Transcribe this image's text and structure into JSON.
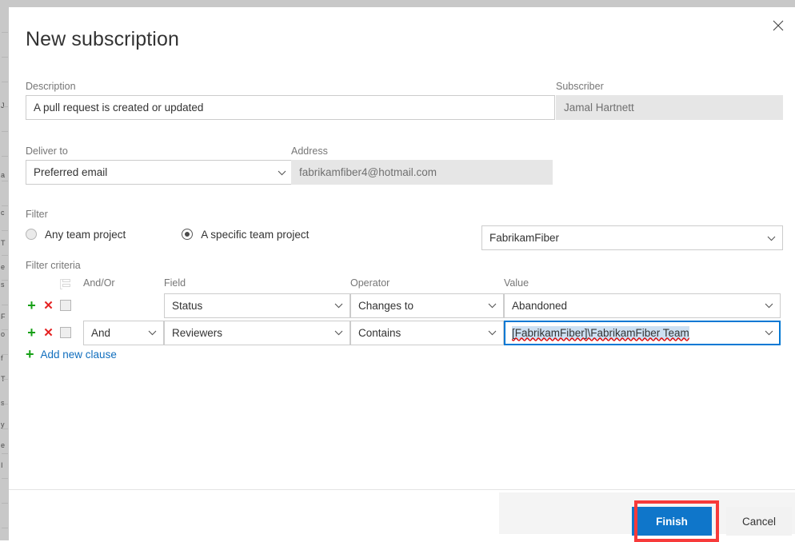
{
  "dialog": {
    "title": "New subscription",
    "close_icon": "close-icon"
  },
  "form": {
    "description_label": "Description",
    "description_value": "A pull request is created or updated",
    "subscriber_label": "Subscriber",
    "subscriber_value": "Jamal Hartnett",
    "deliver_to_label": "Deliver to",
    "deliver_to_value": "Preferred email",
    "address_label": "Address",
    "address_value": "fabrikamfiber4@hotmail.com"
  },
  "filter": {
    "label": "Filter",
    "options": [
      {
        "label": "Any team project",
        "checked": false
      },
      {
        "label": "A specific team project",
        "checked": true
      }
    ],
    "team_project_value": "FabrikamFiber"
  },
  "criteria": {
    "label": "Filter criteria",
    "columns": {
      "grid_icon": "column-options-icon",
      "and_or": "And/Or",
      "field": "Field",
      "operator": "Operator",
      "value": "Value"
    },
    "rows": [
      {
        "add_icon": "add-row-icon",
        "delete_icon": "delete-row-icon",
        "and_or": "",
        "field": "Status",
        "operator": "Changes to",
        "value": "Abandoned",
        "value_focused": false,
        "value_selected": false
      },
      {
        "add_icon": "add-row-icon",
        "delete_icon": "delete-row-icon",
        "and_or": "And",
        "field": "Reviewers",
        "operator": "Contains",
        "value": "[FabrikamFiber]\\FabrikamFiber Team",
        "value_focused": true,
        "value_selected": true
      }
    ],
    "add_clause_label": "Add new clause"
  },
  "footer": {
    "finish_label": "Finish",
    "cancel_label": "Cancel"
  },
  "colors": {
    "accent_blue": "#0f76ca",
    "link_blue": "#106ebe",
    "focus_blue": "#0078d4",
    "selection_blue": "#cde0f2",
    "annotation_red": "#f73a3a",
    "add_green": "#16a016",
    "delete_red": "#e52222",
    "label_gray": "#767676",
    "readonly_gray": "#e6e6e6"
  }
}
